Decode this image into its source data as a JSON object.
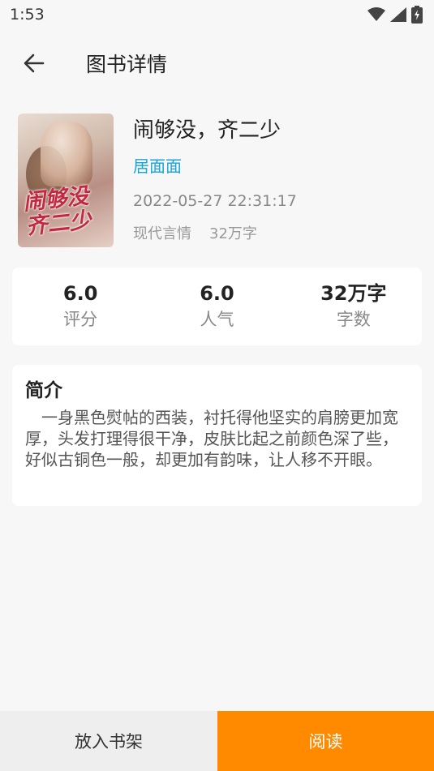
{
  "status_bar": {
    "time": "1:53",
    "icons": [
      "wifi-icon",
      "cell-signal-icon",
      "battery-charging-icon"
    ]
  },
  "app_bar": {
    "back_icon": "arrow-left-icon",
    "title": "图书详情"
  },
  "book": {
    "cover_text": "闹够没 齐二少",
    "title": "闹够没，齐二少",
    "author": "居面面",
    "updated": "2022-05-27 22:31:17",
    "category": "现代言情",
    "word_count": "32万字"
  },
  "stats": [
    {
      "value": "6.0",
      "label": "评分"
    },
    {
      "value": "6.0",
      "label": "人气"
    },
    {
      "value": "32万字",
      "label": "字数"
    }
  ],
  "intro": {
    "heading": "简介",
    "text": "　一身黑色熨帖的西装，衬托得他坚实的肩膀更加宽厚，头发打理得很干净，皮肤比起之前颜色深了些，好似古铜色一般，却更加有韵味，让人移不开眼。"
  },
  "actions": {
    "add_to_shelf": "放入书架",
    "read": "阅读"
  },
  "colors": {
    "accent": "#ff8a00",
    "author_link": "#1aa3d9",
    "background": "#f7f7f7"
  }
}
